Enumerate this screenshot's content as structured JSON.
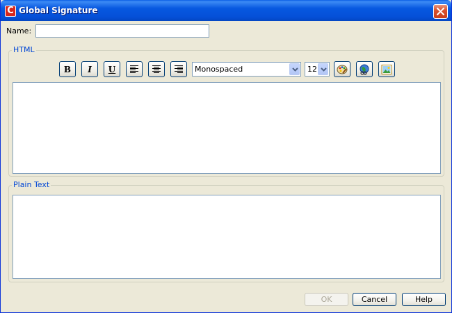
{
  "window": {
    "title": "Global Signature",
    "app_icon_letter": "C"
  },
  "name_field": {
    "label": "Name:",
    "value": ""
  },
  "html_section": {
    "legend": "HTML",
    "toolbar": {
      "bold_label": "B",
      "italic_label": "I",
      "underline_label": "U",
      "font_family": "Monospaced",
      "font_size": "12"
    },
    "content": ""
  },
  "plain_section": {
    "legend": "Plain Text",
    "content": ""
  },
  "buttons": {
    "ok": "OK",
    "cancel": "Cancel",
    "help": "Help"
  },
  "icons": {
    "close": "close-icon",
    "align_left": "align-left-icon",
    "align_center": "align-center-icon",
    "align_right": "align-right-icon",
    "color": "color-palette-icon",
    "link": "globe-link-icon",
    "image": "insert-image-icon"
  },
  "colors": {
    "titlebar": "#0758e0",
    "accent_legend": "#0046d5",
    "dialog_bg": "#ece9d8"
  }
}
